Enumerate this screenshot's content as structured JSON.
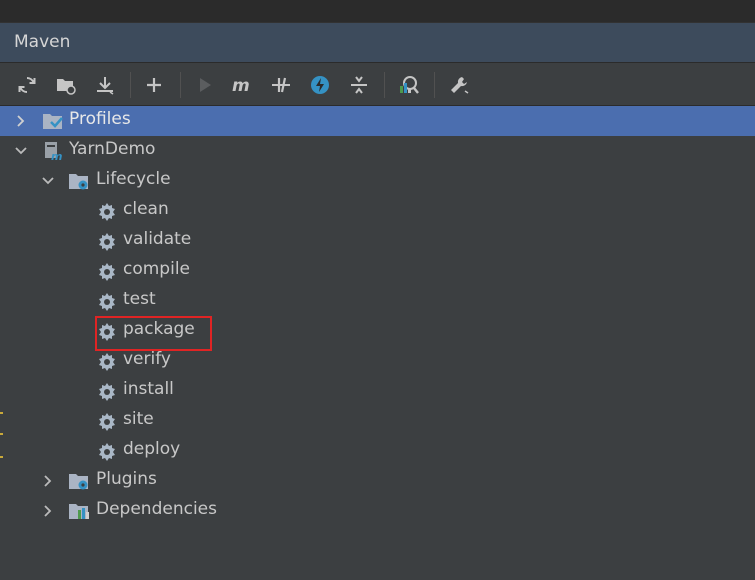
{
  "panel": {
    "title": "Maven"
  },
  "toolbar": {
    "buttons": [
      {
        "icon": "reload-icon"
      },
      {
        "icon": "generate-sources-icon"
      },
      {
        "icon": "download-icon"
      },
      {
        "icon": "add-icon"
      },
      {
        "icon": "run-icon"
      },
      {
        "icon": "execute-goal-icon"
      },
      {
        "icon": "toggle-offline-icon"
      },
      {
        "icon": "skip-tests-icon"
      },
      {
        "icon": "collapse-all-icon"
      },
      {
        "icon": "show-dependencies-icon"
      },
      {
        "icon": "settings-icon"
      }
    ]
  },
  "tree": {
    "profiles": "Profiles",
    "project": "YarnDemo",
    "lifecycle": "Lifecycle",
    "goals": [
      "clean",
      "validate",
      "compile",
      "test",
      "package",
      "verify",
      "install",
      "site",
      "deploy"
    ],
    "plugins": "Plugins",
    "dependencies": "Dependencies"
  },
  "colors": {
    "selection": "#4b6eaf",
    "highlight": "#e02424",
    "accent_blue": "#3592c4"
  }
}
